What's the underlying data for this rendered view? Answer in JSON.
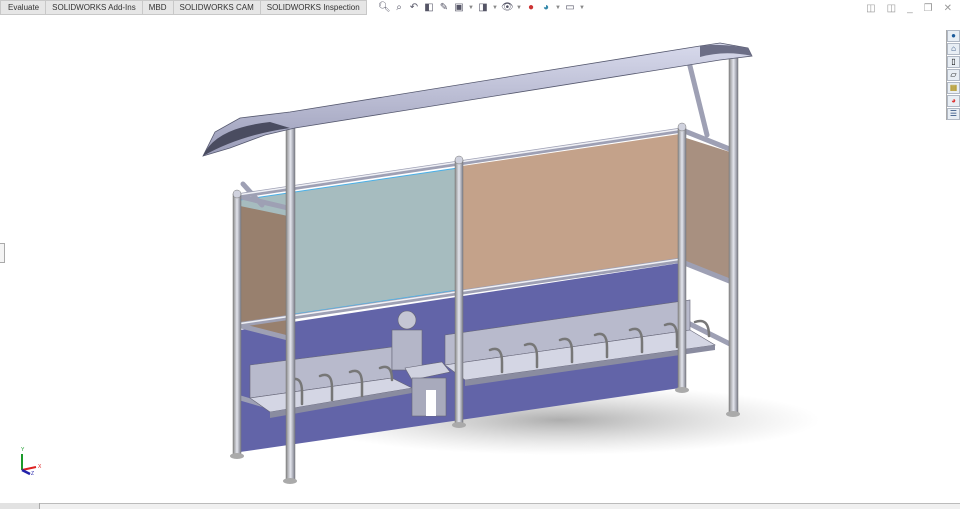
{
  "tabs": [
    {
      "label": "Evaluate"
    },
    {
      "label": "SOLIDWORKS Add-Ins"
    },
    {
      "label": "MBD"
    },
    {
      "label": "SOLIDWORKS CAM"
    },
    {
      "label": "SOLIDWORKS Inspection"
    }
  ],
  "heads_up_toolbar": [
    "zoom-to-fit",
    "zoom-to-area",
    "previous-view",
    "section-view",
    "dynamic-annotation",
    "view-orientation",
    "display-style",
    "hide-show-items",
    "edit-appearance",
    "apply-scene",
    "view-settings"
  ],
  "window_controls": [
    "tile-left",
    "tile-right",
    "minimize",
    "restore",
    "close"
  ],
  "task_pane": [
    "solidworks-resources",
    "design-library",
    "file-explorer",
    "view-palette",
    "appearances",
    "custom-properties",
    "task-list"
  ],
  "triad": {
    "x": "X",
    "y": "Y",
    "z": "Z"
  },
  "colors": {
    "glass": "#a6bcbf",
    "tan": "#c4a28a",
    "purple": "#6264a8",
    "frame": "#c8cadc"
  }
}
